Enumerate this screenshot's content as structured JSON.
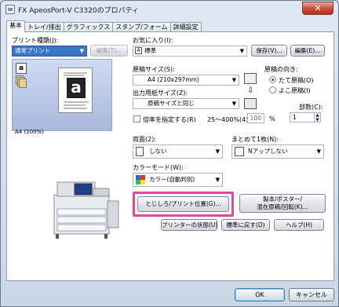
{
  "window": {
    "title": "FX ApeosPort-V C3320のプロパティ",
    "close_label": "✕"
  },
  "tabs": [
    "基本",
    "トレイ/排出",
    "グラフィックス",
    "スタンプ/フォーム",
    "詳細設定"
  ],
  "left": {
    "print_type_label": "プリント種類(J):",
    "print_type_value": "通常プリント",
    "edit_button": "編集(T)...",
    "preview_caption": "A4 (100%)",
    "preview_letter": "a"
  },
  "favorites": {
    "label": "お気に入り(I):",
    "value": "標準",
    "save_button": "保存(V)...",
    "edit_button": "編集(E)..."
  },
  "paper_size": {
    "label": "原稿サイズ(S):",
    "value": "A4 (210x297mm)"
  },
  "output_size": {
    "label": "出力用紙サイズ(Z):",
    "value": "原稿サイズと同じ"
  },
  "orientation": {
    "label": "原稿の向き:",
    "portrait": "たて原稿(O)",
    "landscape": "よこ原稿(I)",
    "selected": "portrait"
  },
  "copies": {
    "label": "部数(C):",
    "value": "1"
  },
  "scale": {
    "label": "倍率を指定する(R)",
    "range": "25～400%(4):",
    "value": "100",
    "unit": "%"
  },
  "duplex": {
    "label": "両面(2):",
    "value": "しない"
  },
  "nup": {
    "label": "まとめて1枚(N):",
    "value": "Nアップしない"
  },
  "color_mode": {
    "label": "カラーモード(W):",
    "value": "カラー(自動判別)"
  },
  "buttons": {
    "binding": "とじしろ/プリント位置(G)...",
    "booklet_line1": "製本/ポスター/",
    "booklet_line2": "混在原稿/回転(K)...",
    "printer_status": "プリンターの状態(U)",
    "defaults": "標準に戻す(D)",
    "help": "ヘルプ(H)"
  },
  "footer": {
    "ok": "OK",
    "cancel": "キャンセル"
  },
  "colors": {
    "highlight": "#e0489a",
    "accent": "#3a74c4"
  }
}
